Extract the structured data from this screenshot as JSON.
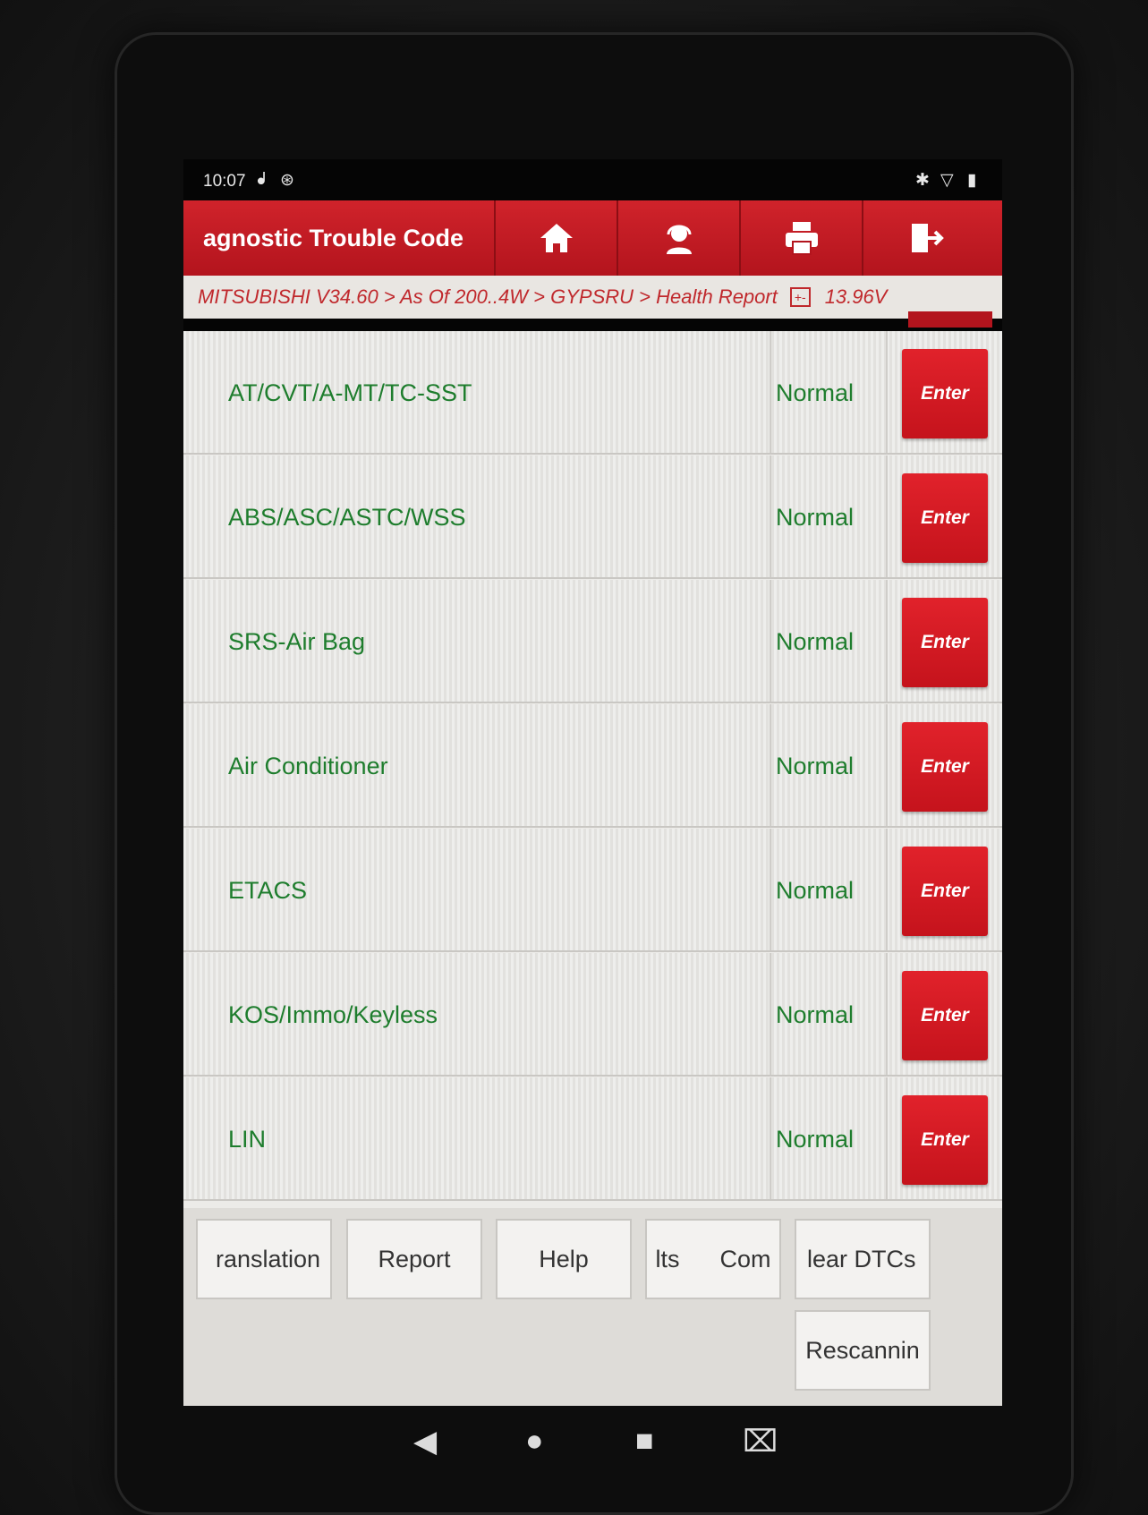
{
  "status_bar": {
    "time": "10:07"
  },
  "header": {
    "title": "agnostic Trouble Code"
  },
  "breadcrumb": {
    "path": "MITSUBISHI V34.60 > As Of 200..4W > GYPSRU > Health Report",
    "voltage": "13.96V"
  },
  "systems": [
    {
      "name": "AT/CVT/A-MT/TC-SST",
      "status": "Normal",
      "button": "Enter"
    },
    {
      "name": "ABS/ASC/ASTC/WSS",
      "status": "Normal",
      "button": "Enter"
    },
    {
      "name": "SRS-Air Bag",
      "status": "Normal",
      "button": "Enter"
    },
    {
      "name": "Air Conditioner",
      "status": "Normal",
      "button": "Enter"
    },
    {
      "name": "ETACS",
      "status": "Normal",
      "button": "Enter"
    },
    {
      "name": "KOS/Immo/Keyless",
      "status": "Normal",
      "button": "Enter"
    },
    {
      "name": "LIN",
      "status": "Normal",
      "button": "Enter"
    }
  ],
  "bottom_buttons": {
    "translation": "ranslation",
    "report": "Report",
    "help": "Help",
    "results_compare": "lts      Com",
    "clear_dtcs": "lear DTCs",
    "rescanning": "Rescannin"
  },
  "colors": {
    "brand_red": "#c5131c",
    "status_green": "#1e7d2d",
    "breadcrumb_text": "#c0282c"
  },
  "icons": {
    "header": [
      "home-icon",
      "support-icon",
      "print-icon",
      "exit-icon"
    ],
    "status": [
      "usb-debug-icon",
      "bluetooth-status-icon",
      "bluetooth-icon",
      "wifi-icon",
      "battery-icon"
    ],
    "nav": [
      "back-icon",
      "home-nav-icon",
      "recents-icon",
      "screenshot-icon"
    ]
  }
}
